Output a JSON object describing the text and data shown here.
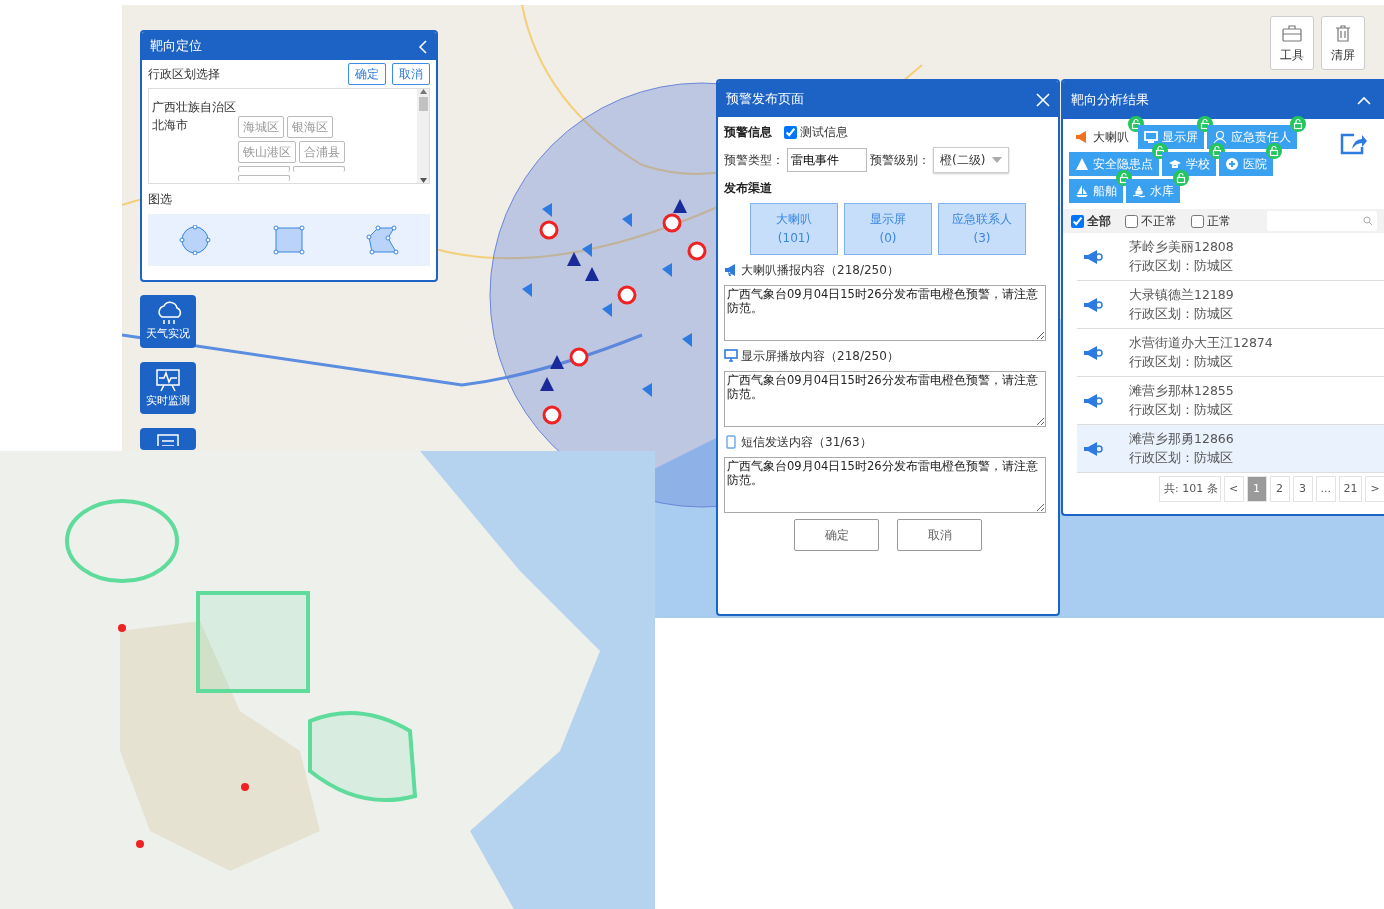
{
  "left_panel": {
    "title": "靶向定位",
    "region_label": "行政区划选择",
    "confirm": "确定",
    "cancel": "取消",
    "tree": {
      "province": "广西壮族自治区",
      "city": "北海市",
      "districts": [
        "海城区",
        "银海区",
        "铁山港区",
        "合浦县"
      ]
    },
    "draw_label": "图选"
  },
  "side_buttons": [
    {
      "label": "天气实况"
    },
    {
      "label": "实时监测"
    }
  ],
  "tools": [
    {
      "label": "工具"
    },
    {
      "label": "清屏"
    }
  ],
  "warning_dialog": {
    "title": "预警发布页面",
    "info_label": "预警信息",
    "test": {
      "label": "测试信息",
      "checked": true
    },
    "type_label": "预警类型：",
    "type_value": "雷电事件",
    "level_label": "预警级别：",
    "level_value": "橙(二级)",
    "channels_label": "发布渠道",
    "channels": [
      {
        "name": "大喇叭",
        "count": "(101)"
      },
      {
        "name": "显示屏",
        "count": "(0)"
      },
      {
        "name": "应急联系人",
        "count": "(3)"
      }
    ],
    "contents": [
      {
        "label": "大喇叭播报内容（218/250）",
        "text": "广西气象台09月04日15时26分发布雷电橙色预警，请注意防范。"
      },
      {
        "label": "显示屏播放内容（218/250）",
        "text": "广西气象台09月04日15时26分发布雷电橙色预警，请注意防范。"
      },
      {
        "label": "短信发送内容（31/63）",
        "text": "广西气象台09月04日15时26分发布雷电橙色预警，请注意防范。"
      }
    ],
    "buttons": [
      "确定",
      "取消"
    ]
  },
  "result_panel": {
    "title": "靶向分析结果",
    "tags": [
      {
        "label": "大喇叭",
        "selected": true
      },
      {
        "label": "显示屏",
        "selected": false
      },
      {
        "label": "应急责任人",
        "selected": false
      },
      {
        "label": "安全隐患点",
        "selected": false
      },
      {
        "label": "学校",
        "selected": false
      },
      {
        "label": "医院",
        "selected": false
      },
      {
        "label": "船舶",
        "selected": false
      },
      {
        "label": "水库",
        "selected": false
      }
    ],
    "filters": [
      {
        "label": "全部",
        "checked": true
      },
      {
        "label": "不正常",
        "checked": false
      },
      {
        "label": "正常",
        "checked": false
      }
    ],
    "items": [
      {
        "name": "茅岭乡美丽12808",
        "region": "行政区划：防城区",
        "selected": false
      },
      {
        "name": "大录镇德兰12189",
        "region": "行政区划：防城区",
        "selected": false
      },
      {
        "name": "水营街道办大王江12874",
        "region": "行政区划：防城区",
        "selected": false
      },
      {
        "name": "滩营乡那林12855",
        "region": "行政区划：防城区",
        "selected": false
      },
      {
        "name": "滩营乡那勇12866",
        "region": "行政区划：防城区",
        "selected": true
      }
    ],
    "pagination": {
      "total": "共: 101 条",
      "prev": "<",
      "pages": [
        {
          "label": "1",
          "selected": true
        },
        {
          "label": "2",
          "selected": false
        },
        {
          "label": "3",
          "selected": false
        },
        {
          "label": "...",
          "selected": false
        },
        {
          "label": "21",
          "selected": false
        }
      ],
      "next": ">"
    }
  }
}
